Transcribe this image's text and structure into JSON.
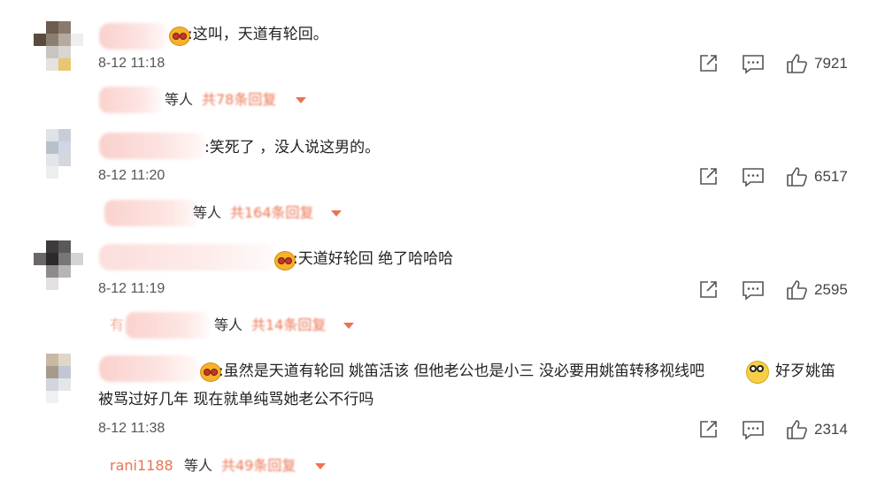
{
  "comments": [
    {
      "text": ":这叫，天道有轮回。",
      "time": "8-12 11:18",
      "likes": "7921",
      "reply_prefix": "",
      "reply_label": "等人",
      "reply_count": "共78条回复"
    },
    {
      "text": ":笑死了 ，没人说这男的。",
      "time": "8-12 11:20",
      "likes": "6517",
      "reply_prefix": "",
      "reply_label": "等人",
      "reply_count": "共164条回复"
    },
    {
      "text": ":天道好轮回 绝了哈哈哈",
      "time": "8-12 11:19",
      "likes": "2595",
      "reply_prefix": "有",
      "reply_label": "等人",
      "reply_count": "共14条回复"
    },
    {
      "text_line1_a": ":虽然是天道有轮回 姚笛活该 但他老公也是小三 没必要用姚笛转移视线吧",
      "text_line1_b": "好歹姚笛",
      "text_line2": "被骂过好几年 现在就单纯骂她老公不行吗",
      "time": "8-12 11:38",
      "likes": "2314",
      "reply_prefix": "rani1188",
      "reply_label": "等人",
      "reply_count": "共49条回复"
    }
  ],
  "icons": {
    "share": "share-icon",
    "comment": "comment-icon",
    "like": "like-icon",
    "expand": "chevron-down-icon"
  },
  "colors": {
    "accent": "#eb7350",
    "text": "#222222",
    "muted": "#555555"
  }
}
